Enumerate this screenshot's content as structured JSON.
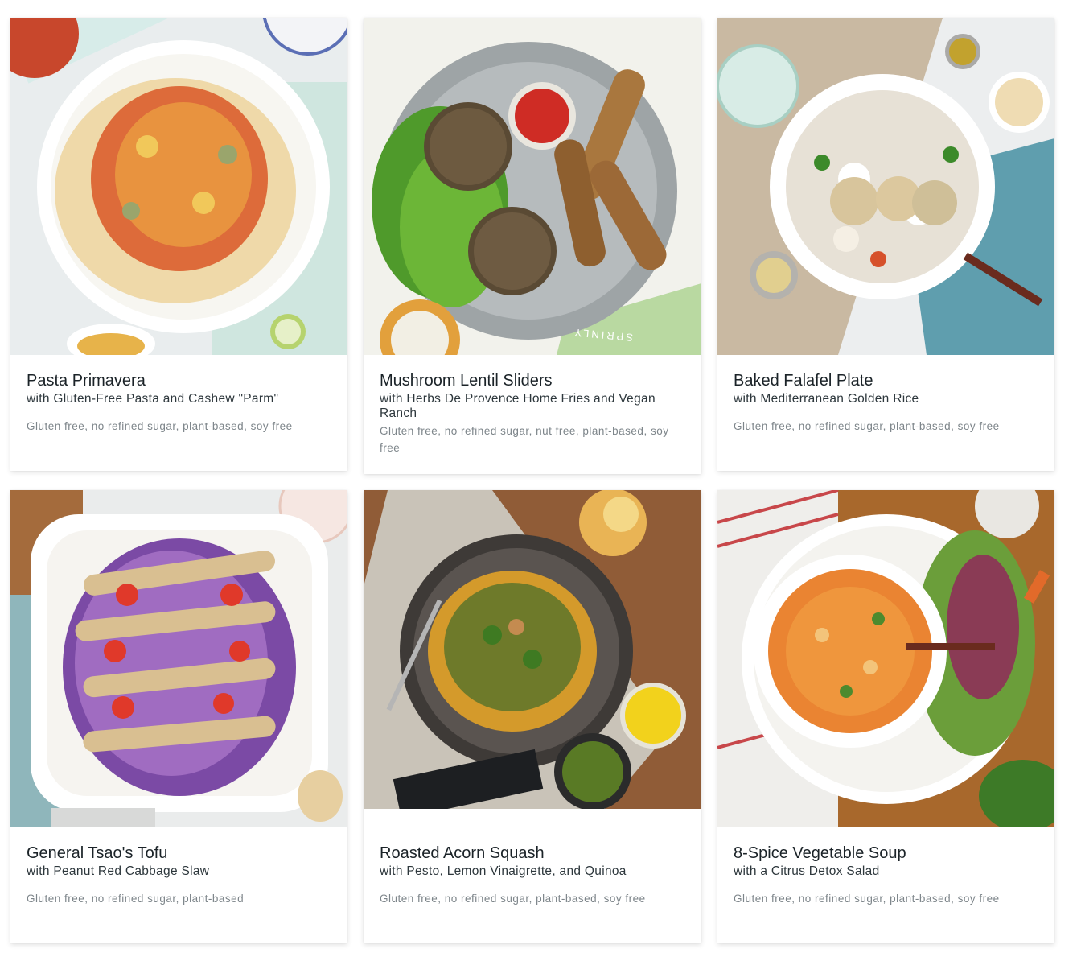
{
  "meals": [
    {
      "title": "Pasta Primavera",
      "subtitle": "with Gluten-Free Pasta and Cashew \"Parm\"",
      "tags": "Gluten free, no refined sugar, plant-based, soy free"
    },
    {
      "title": "Mushroom Lentil Sliders",
      "subtitle": "with Herbs De Provence Home Fries and Vegan Ranch",
      "tags": "Gluten free, no refined sugar, nut free, plant-based, soy free"
    },
    {
      "title": "Baked Falafel Plate",
      "subtitle": "with Mediterranean Golden Rice",
      "tags": "Gluten free, no refined sugar, plant-based, soy free"
    },
    {
      "title": "General Tsao's Tofu",
      "subtitle": "with Peanut Red Cabbage Slaw",
      "tags": "Gluten free, no refined sugar, plant-based"
    },
    {
      "title": "Roasted Acorn Squash",
      "subtitle": "with Pesto, Lemon Vinaigrette, and Quinoa",
      "tags": "Gluten free, no refined sugar, plant-based, soy free"
    },
    {
      "title": "8-Spice Vegetable Soup",
      "subtitle": "with a Citrus Detox Salad",
      "tags": "Gluten free, no refined sugar, plant-based, soy free"
    }
  ],
  "photo_label": "SPRINLY",
  "colors": {
    "title": "#1b2328",
    "subtitle": "#2d373c",
    "tags": "#7d858a"
  }
}
